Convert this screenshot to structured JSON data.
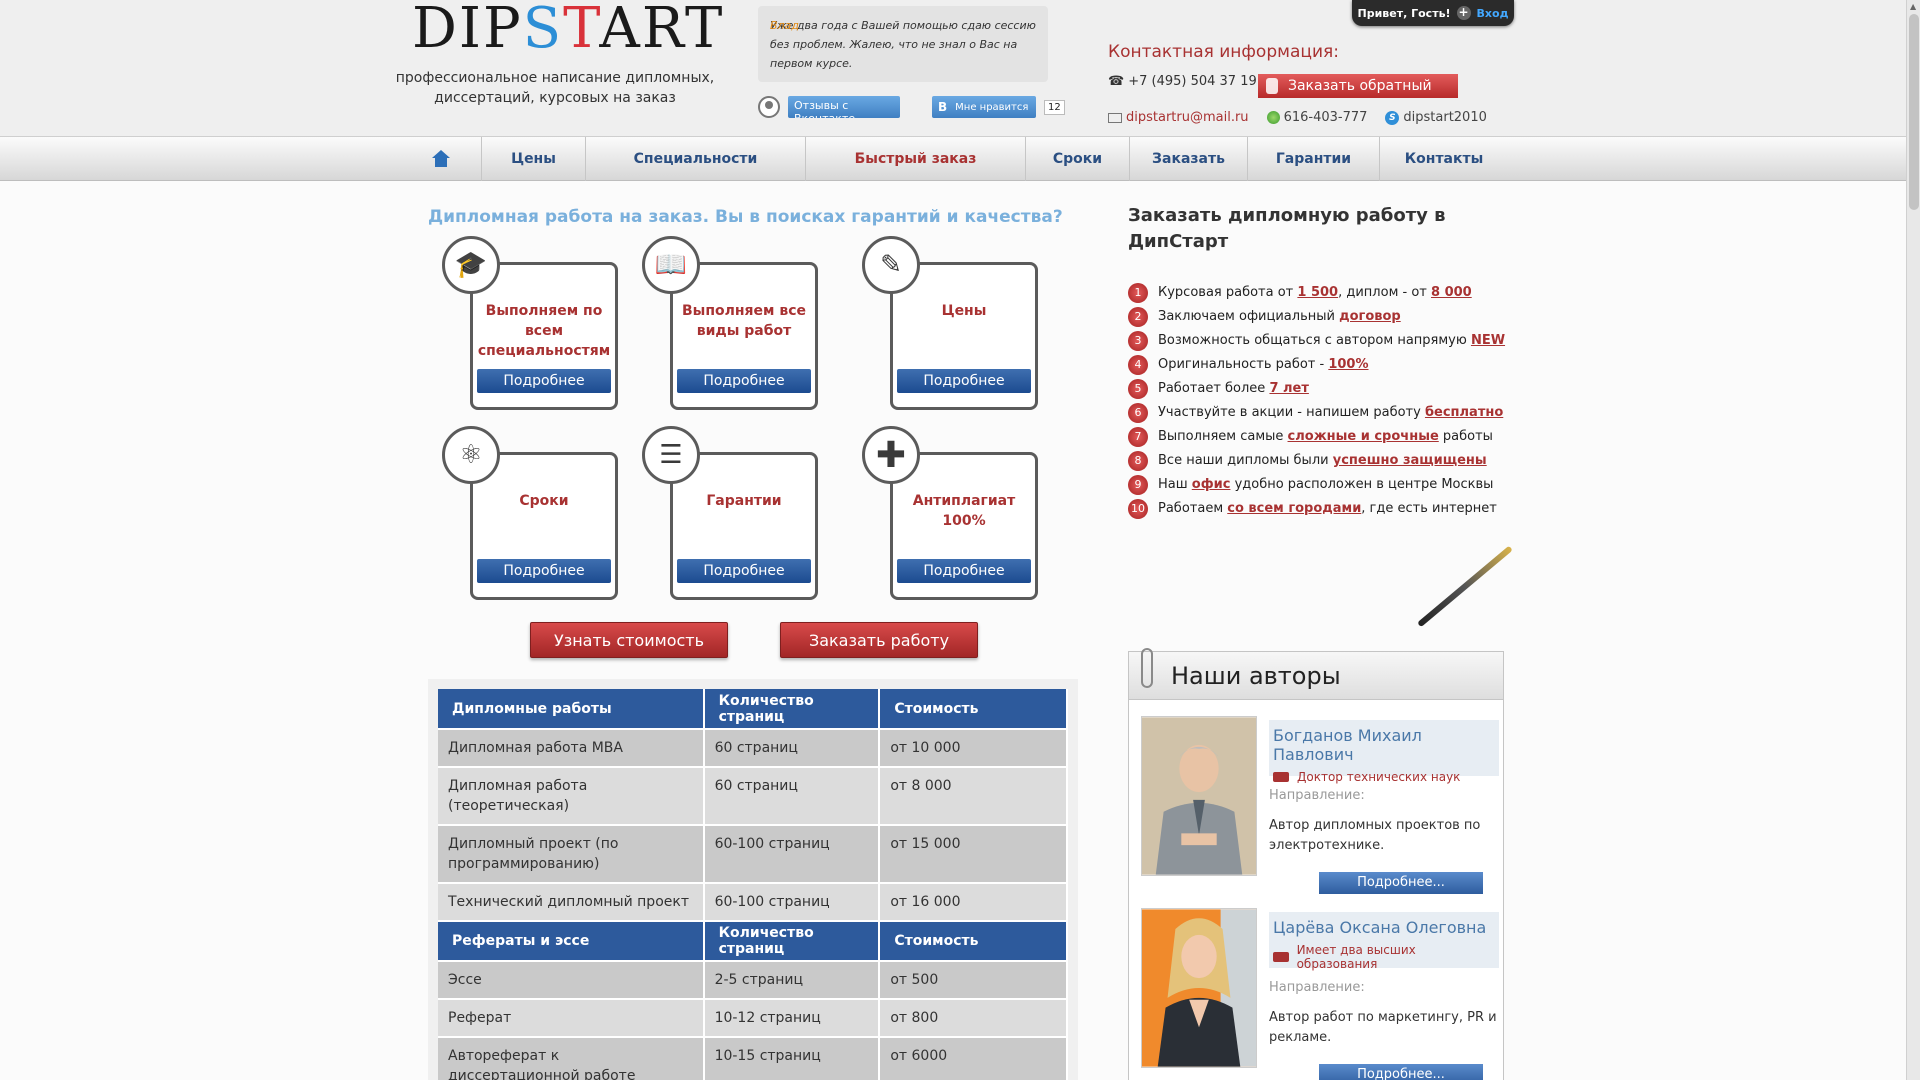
{
  "userbar": {
    "greeting": "Привет, Гость!",
    "login": "Вход"
  },
  "header": {
    "logo": {
      "a": "DIP",
      "s": "S",
      "t": "T",
      "rest": "ART"
    },
    "tagline": "профессиональное написание дипломных, диссертаций, курсовых на заказ",
    "review": {
      "author": "Влад",
      "text": "Уже два года с Вашей помощью сдаю сессию без проблем. Жалею, что не знал о Вас на первом курсе.",
      "reviews_button": "Отзывы с Вконтакте",
      "like_button": "Мне нравится",
      "like_count": "12"
    },
    "contacts": {
      "title": "Контактная информация:",
      "phone": "+7 (495) 504 37 19",
      "callback": "Заказать обратный",
      "email": "dipstartru@mail.ru",
      "icq": "616-403-777",
      "skype": "dipstart2010"
    }
  },
  "nav": [
    "Цены",
    "Специальности",
    "Быстрый заказ",
    "Сроки",
    "Заказать",
    "Гарантии",
    "Контакты"
  ],
  "headline": "Дипломная работа на заказ. Вы в поисках гарантий и качества?",
  "cards": [
    {
      "title": "Выполняем по всем специальностям",
      "icon": "graduation-cap-icon",
      "more": "Подробнее"
    },
    {
      "title": "Выполняем все виды работ",
      "icon": "book-icon",
      "more": "Подробнее"
    },
    {
      "title": "Цены",
      "icon": "compass-icon",
      "more": "Подробнее"
    },
    {
      "title": "Сроки",
      "icon": "molecule-icon",
      "more": "Подробнее"
    },
    {
      "title": "Гарантии",
      "icon": "document-icon",
      "more": "Подробнее"
    },
    {
      "title": "Антиплагиат 100%",
      "icon": "plus-icon",
      "more": "Подробнее"
    }
  ],
  "buttons": {
    "price": "Узнать стоимость",
    "order": "Заказать работу"
  },
  "price_table": {
    "sections": [
      {
        "headers": [
          "Дипломные работы",
          "Количество страниц",
          "Стоимость"
        ],
        "rows": [
          [
            "Дипломная работа MBA",
            "60 страниц",
            "от 10 000"
          ],
          [
            "Дипломная работа (теоретическая)",
            "60 страниц",
            "от 8 000"
          ],
          [
            "Дипломный проект (по программированию)",
            "60-100 страниц",
            "от 15 000"
          ],
          [
            "Технический дипломный проект",
            "60-100 страниц",
            "от 16 000"
          ]
        ]
      },
      {
        "headers": [
          "Рефераты и эссе",
          "Количество страниц",
          "Стоимость"
        ],
        "rows": [
          [
            "Эссе",
            "2-5 страниц",
            "от 500"
          ],
          [
            "Реферат",
            "10-12 страниц",
            "от 800"
          ],
          [
            "Автореферат к диссертационной работе",
            "10-15 страниц",
            "от 6000"
          ]
        ]
      }
    ]
  },
  "right": {
    "title": "Заказать дипломную работу в ДипСтарт",
    "advantages": [
      {
        "n": "1",
        "pre": "Курсовая работа от ",
        "l1": "1 500",
        "mid": ", диплом - от ",
        "l2": "8 000",
        "post": ""
      },
      {
        "n": "2",
        "pre": "Заключаем официальный ",
        "l1": "договор",
        "mid": "",
        "l2": "",
        "post": ""
      },
      {
        "n": "3",
        "pre": "Возможность общаться с автором напрямую ",
        "l1": "NEW",
        "mid": "",
        "l2": "",
        "post": ""
      },
      {
        "n": "4",
        "pre": "Оригинальность работ - ",
        "l1": "100%",
        "mid": "",
        "l2": "",
        "post": ""
      },
      {
        "n": "5",
        "pre": "Работает более ",
        "l1": "7 лет",
        "mid": "",
        "l2": "",
        "post": ""
      },
      {
        "n": "6",
        "pre": "Участвуйте в акции - напишем работу ",
        "l1": "бесплатно",
        "mid": "",
        "l2": "",
        "post": ""
      },
      {
        "n": "7",
        "pre": "Выполняем самые ",
        "l1": "сложные и срочные",
        "mid": "",
        "l2": "",
        "post": " работы"
      },
      {
        "n": "8",
        "pre": "Все наши дипломы были ",
        "l1": "успешно защищены",
        "mid": "",
        "l2": "",
        "post": ""
      },
      {
        "n": "9",
        "pre": "Наш ",
        "l1": "офис",
        "mid": "",
        "l2": "",
        "post": " удобно расположен в центре Москвы"
      },
      {
        "n": "10",
        "pre": "Работаем ",
        "l1": "со всем городами",
        "mid": "",
        "l2": "",
        "post": ", где есть интернет"
      }
    ],
    "authors": {
      "title": "Наши авторы",
      "dir_label": "Направление:",
      "list": [
        {
          "name": "Богданов Михаил Павлович",
          "degree": "Доктор технических наук",
          "desc": "Автор дипломных проектов по электротехнике.",
          "more": "Подробнее..."
        },
        {
          "name": "Царёва Оксана Олеговна",
          "degree": "Имеет два высших образования",
          "desc": "Автор работ по маркетингу, PR и рекламе.",
          "more": "Подробнее..."
        }
      ]
    }
  }
}
